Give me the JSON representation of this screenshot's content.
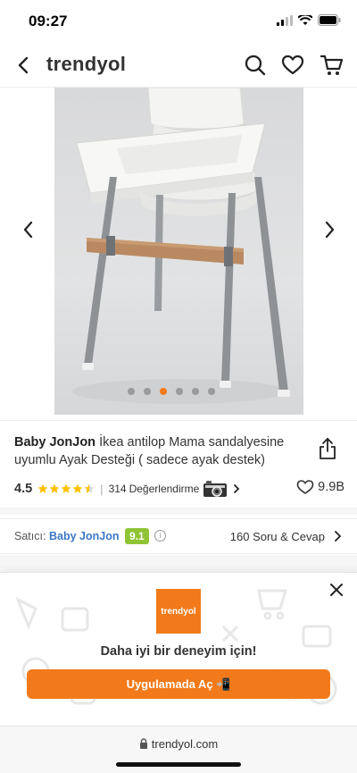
{
  "status_bar": {
    "time": "09:27"
  },
  "header": {
    "logo": "trendyol"
  },
  "gallery": {
    "image_count": 6,
    "active_index": 2
  },
  "product": {
    "brand": "Baby JonJon",
    "title": "İkea antilop Mama sandalyesine uyumlu Ayak Desteği ( sadece ayak destek)",
    "rating": "4.5",
    "rating_value": 4.5,
    "review_count": "314",
    "review_label": "Değerlendirme",
    "favorites": "9.9B"
  },
  "seller": {
    "label": "Satıcı:",
    "name": "Baby JonJon",
    "score": "9.1",
    "qa": "160 Soru & Cevap"
  },
  "app_banner": {
    "logo_text": "trendyol",
    "message": "Daha iyi bir deneyim için!",
    "button_label": "Uygulamada Aç 📲"
  },
  "url_bar": {
    "url": "trendyol.com"
  },
  "colors": {
    "accent": "#f27a1a",
    "seller_link": "#3a77c7",
    "score_badge": "#8fc435"
  }
}
